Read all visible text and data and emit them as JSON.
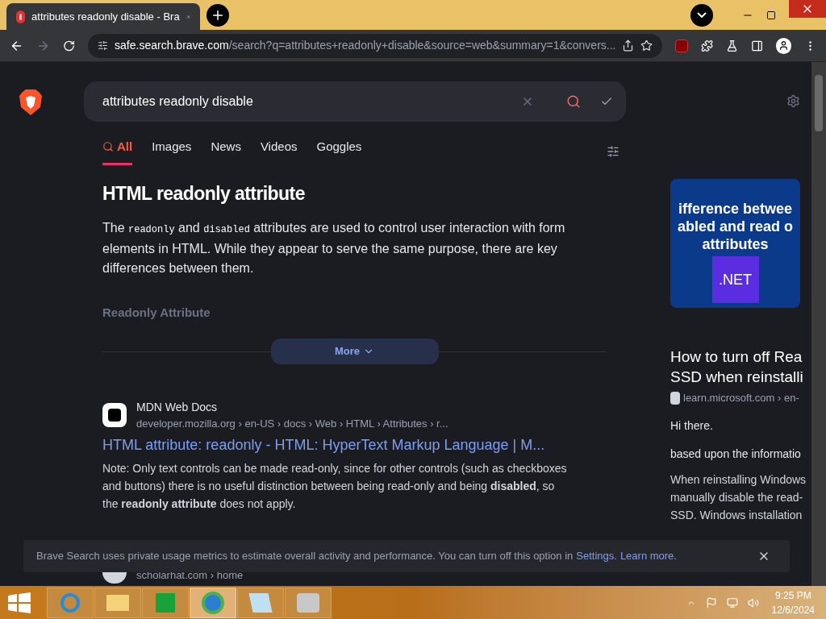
{
  "browser": {
    "tab_title": "attributes readonly disable - Bra",
    "url_domain": "safe.search.brave.com",
    "url_path": "/search?q=attributes+readonly+disable&source=web&summary=1&convers..."
  },
  "search": {
    "query": "attributes readonly disable"
  },
  "nav_tabs": [
    {
      "label": "All",
      "selected": true
    },
    {
      "label": "Images",
      "selected": false
    },
    {
      "label": "News",
      "selected": false
    },
    {
      "label": "Videos",
      "selected": false
    },
    {
      "label": "Goggles",
      "selected": false
    }
  ],
  "summary": {
    "title": "HTML readonly attribute",
    "paragraph": [
      {
        "kind": "text",
        "text": "The "
      },
      {
        "kind": "code",
        "text": "readonly"
      },
      {
        "kind": "text",
        "text": " and "
      },
      {
        "kind": "code",
        "text": "disabled"
      },
      {
        "kind": "text",
        "text": " attributes are used to control user interaction with form elements in HTML. While they appear to serve the same purpose, there are key differences between them."
      }
    ],
    "subheading": "Readonly Attribute",
    "more_button": "More"
  },
  "results": [
    {
      "site": "MDN Web Docs",
      "breadcrumb": "developer.mozilla.org › en-US › docs › Web › HTML › Attributes › r...",
      "title": "HTML attribute: readonly - HTML: HyperText Markup Language | M...",
      "snippet": "Note: Only text controls can be made read-only, since for other controls (such as checkboxes and buttons) there is no useful distinction between being read-only and being **disabled**, so the **readonly attribute** does not apply."
    },
    {
      "breadcrumb": "scholarhat.com › home"
    }
  ],
  "side_panel": {
    "thumbnail_lines": [
      "ifference betwee",
      "abled and read o",
      "attributes"
    ],
    "thumbnail_badge": ".NET",
    "title_lines": [
      "How to turn off Rea",
      "SSD when reinstalli"
    ],
    "source": "learn.microsoft.com › en-",
    "paragraphs": [
      "Hi there.",
      "based upon the informatio"
    ],
    "lines": [
      "When reinstalling Windows",
      "manually disable the read-",
      "SSD. Windows installation"
    ]
  },
  "banner": {
    "text": "Brave Search uses private usage metrics to estimate overall activity and performance. You can turn off this option in",
    "settings_link": "Settings.",
    "learn_link": "Learn more."
  },
  "taskbar": {
    "time": "9:25 PM",
    "date": "12/6/2024"
  }
}
